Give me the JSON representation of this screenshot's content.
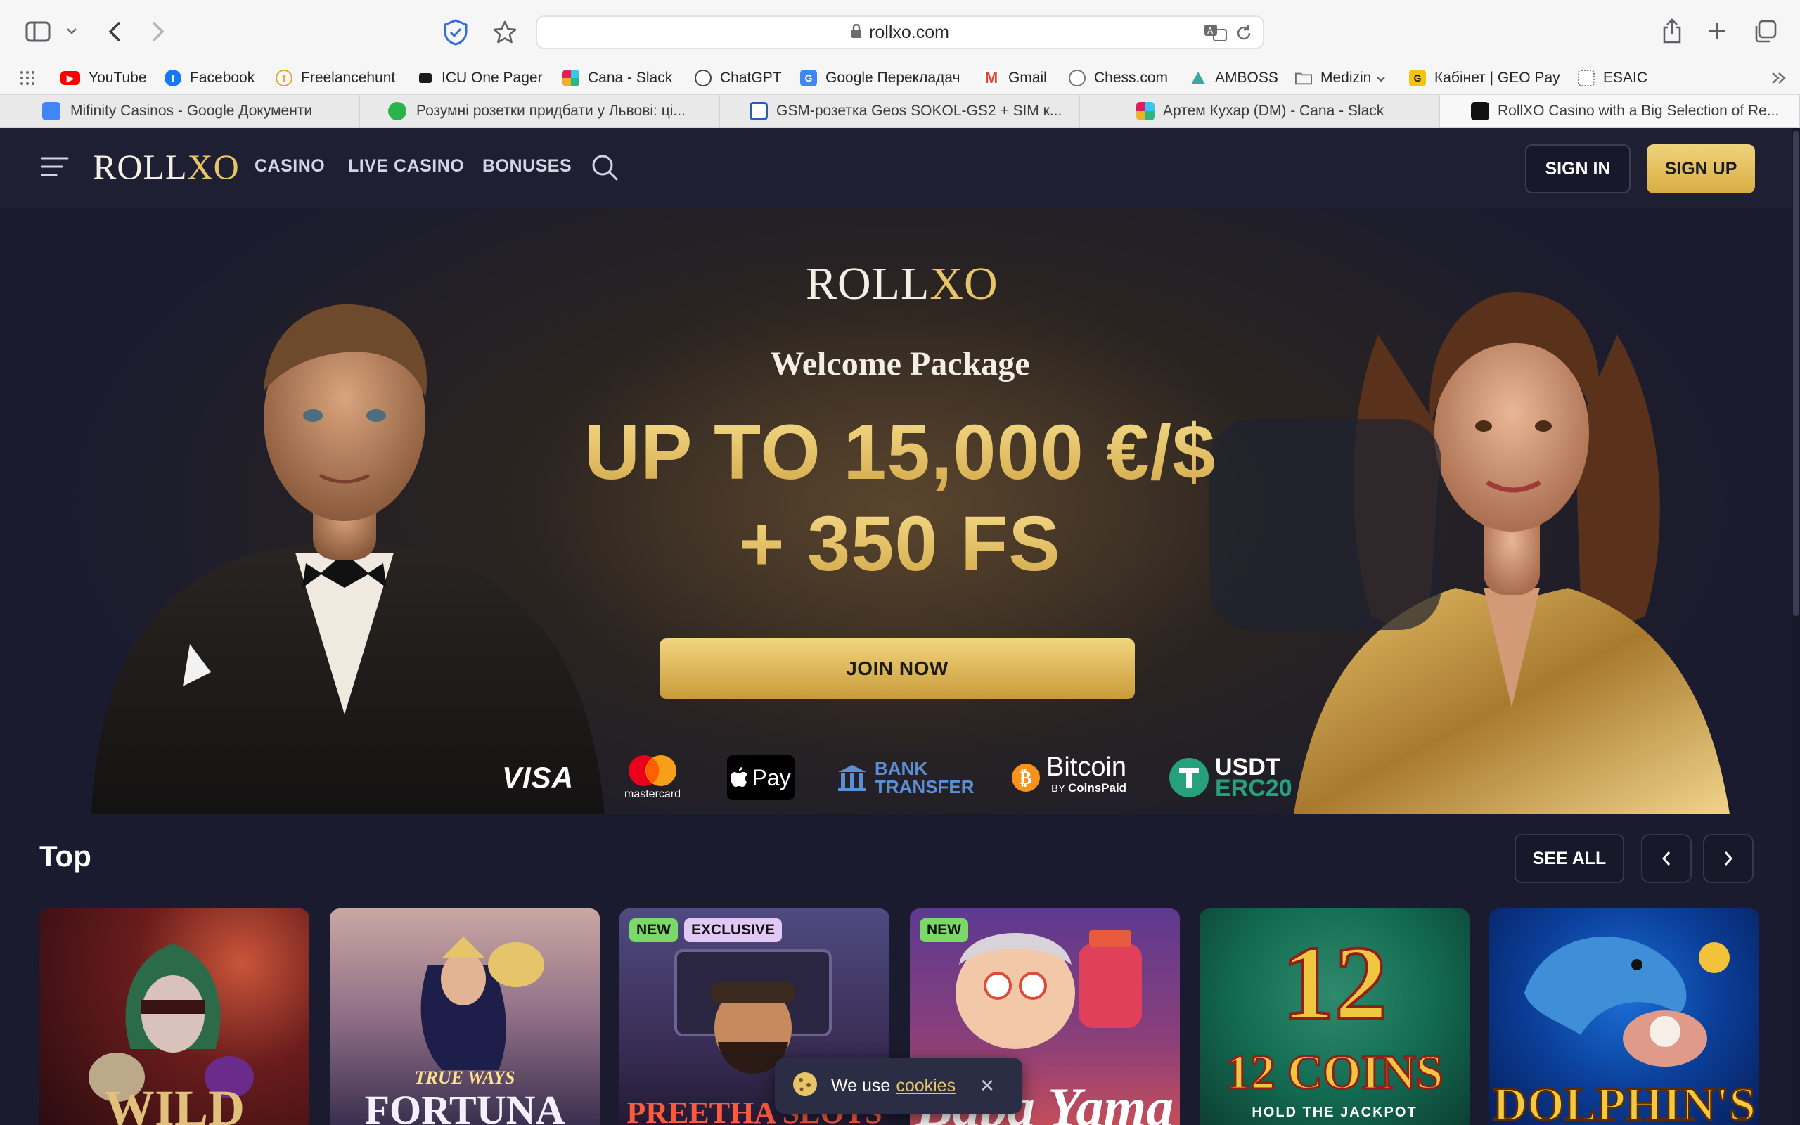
{
  "browser": {
    "url": "rollxo.com",
    "bookmarks": [
      {
        "label": "YouTube",
        "icon": "youtube-icon"
      },
      {
        "label": "Facebook",
        "icon": "facebook-icon"
      },
      {
        "label": "Freelancehunt",
        "icon": "freelancehunt-icon"
      },
      {
        "label": "ICU One Pager",
        "icon": "icu-icon"
      },
      {
        "label": "Cana - Slack",
        "icon": "slack-icon"
      },
      {
        "label": "ChatGPT",
        "icon": "chatgpt-icon"
      },
      {
        "label": "Google Перекладач",
        "icon": "google-translate-icon"
      },
      {
        "label": "Gmail",
        "icon": "gmail-icon"
      },
      {
        "label": "Chess.com",
        "icon": "globe-icon"
      },
      {
        "label": "AMBOSS",
        "icon": "amboss-icon"
      },
      {
        "label": "Medizin",
        "icon": "folder-icon"
      },
      {
        "label": "Кабінет | GEO Pay",
        "icon": "geopay-icon"
      },
      {
        "label": "ESAIC",
        "icon": "esaic-icon"
      }
    ],
    "tabs": [
      {
        "label": "Mifinity Casinos - Google Документи"
      },
      {
        "label": "Розумні розетки придбати у Львові: ці..."
      },
      {
        "label": "GSM-розетка Geos SOKOL-GS2 + SIM к..."
      },
      {
        "label": "Артем Кухар (DM) - Cana - Slack"
      },
      {
        "label": "RollXO Casino with a Big Selection of Re..."
      }
    ]
  },
  "site": {
    "logo": {
      "roll": "ROLL",
      "xo": "XO"
    },
    "nav": [
      "CASINO",
      "LIVE CASINO",
      "BONUSES"
    ],
    "sign_in": "SIGN IN",
    "sign_up": "SIGN UP"
  },
  "hero": {
    "subtitle": "Welcome Package",
    "line1": "UP TO 15,000 €/$",
    "line2": "+ 350 FS",
    "cta": "JOIN NOW",
    "payments": {
      "visa": "VISA",
      "mastercard": "mastercard",
      "applepay": "Pay",
      "bank_line1": "BANK",
      "bank_line2": "TRANSFER",
      "bitcoin": "Bitcoin",
      "bitcoin_by": "BY",
      "bitcoin_coinspaid": "CoinsPaid",
      "usdt": "USDT",
      "erc20": "ERC20"
    }
  },
  "top": {
    "title": "Top",
    "see_all": "SEE ALL",
    "games": [
      {
        "title": "WILD",
        "badges": []
      },
      {
        "title": "FORTUNA",
        "subtitle": "TRUE WAYS",
        "badges": []
      },
      {
        "title": "PREETHA SLOTS",
        "badges": [
          "NEW",
          "EXCLUSIVE"
        ]
      },
      {
        "title": "Baba Yama",
        "badges": [
          "NEW"
        ]
      },
      {
        "title": "12 COINS",
        "subtitle": "HOLD THE JACKPOT",
        "badges": []
      },
      {
        "title": "DOLPHIN'S",
        "badges": []
      }
    ]
  },
  "cookie": {
    "text": "We use",
    "link": "cookies"
  },
  "colors": {
    "gold": "#e6c56a",
    "bg": "#1e1f33",
    "new_badge": "#7bd96a",
    "exclusive_badge": "#e2c8f5"
  }
}
